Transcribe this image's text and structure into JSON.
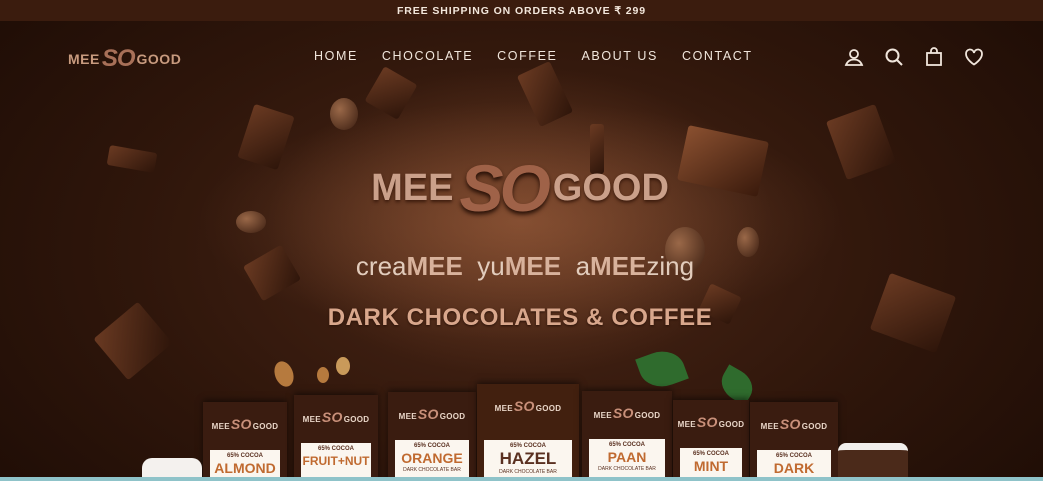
{
  "announcement": "FREE SHIPPING ON ORDERS ABOVE ₹ 299",
  "logo": {
    "part1": "MEE",
    "part2": "SO",
    "part3": "GOOD"
  },
  "nav": [
    "HOME",
    "CHOCOLATE",
    "COFFEE",
    "ABOUT US",
    "CONTACT"
  ],
  "icons": [
    "account-icon",
    "search-icon",
    "cart-icon",
    "wishlist-icon"
  ],
  "hero": {
    "logo": {
      "part1": "MEE",
      "part2": "SO",
      "part3": "GOOD"
    },
    "tagline": [
      {
        "pre": "crea",
        "bold": "MEE",
        "post": ""
      },
      {
        "pre": "yu",
        "bold": "MEE",
        "post": ""
      },
      {
        "pre": "a",
        "bold": "MEE",
        "post": "zing"
      }
    ],
    "headline": "DARK CHOCOLATES & COFFEE"
  },
  "products": [
    {
      "brand1": "MEE",
      "brand2": "SO",
      "brand3": "GOOD",
      "cocoa": "65% COCOA",
      "flavor": "ALMOND",
      "sub": ""
    },
    {
      "brand1": "MEE",
      "brand2": "SO",
      "brand3": "GOOD",
      "cocoa": "65% COCOA",
      "flavor": "FRUIT+NUT",
      "sub": ""
    },
    {
      "brand1": "MEE",
      "brand2": "SO",
      "brand3": "GOOD",
      "cocoa": "65% COCOA",
      "flavor": "ORANGE",
      "sub": "DARK CHOCOLATE BAR"
    },
    {
      "brand1": "MEE",
      "brand2": "SO",
      "brand3": "GOOD",
      "cocoa": "65% COCOA",
      "flavor": "HAZEL",
      "sub": "DARK CHOCOLATE BAR"
    },
    {
      "brand1": "MEE",
      "brand2": "SO",
      "brand3": "GOOD",
      "cocoa": "65% COCOA",
      "flavor": "PAAN",
      "sub": "DARK CHOCOLATE BAR"
    },
    {
      "brand1": "MEE",
      "brand2": "SO",
      "brand3": "GOOD",
      "cocoa": "65% COCOA",
      "flavor": "MINT",
      "sub": ""
    },
    {
      "brand1": "MEE",
      "brand2": "SO",
      "brand3": "GOOD",
      "cocoa": "65% COCOA",
      "flavor": "DARK",
      "sub": ""
    }
  ],
  "colors": {
    "announcement_bg": "#3b1c0e",
    "hero_bg": "#2f160b",
    "accent": "#d9a78c"
  }
}
